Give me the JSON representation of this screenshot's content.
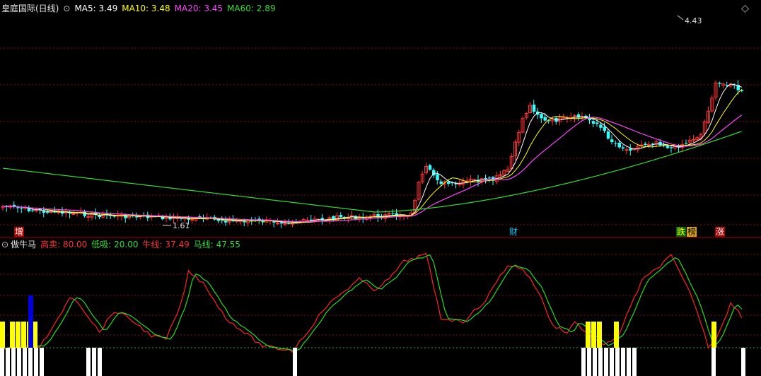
{
  "main_panel": {
    "title": "皇庭国际(日线)",
    "ma_labels": [
      {
        "text": "MA5: 3.49",
        "color": "#ffffff"
      },
      {
        "text": "MA10: 3.48",
        "color": "#ffff00"
      },
      {
        "text": "MA20: 3.45",
        "color": "#ff44ff"
      },
      {
        "text": "MA60: 2.89",
        "color": "#33dd33"
      }
    ],
    "high_label": "4.43",
    "low_label": "1.61",
    "event_tags": [
      {
        "text": "增",
        "color": "#ffffff",
        "bg": "#aa0000"
      },
      {
        "text": "财",
        "color": "#00ccff",
        "bg": "#000000"
      },
      {
        "text": "跌",
        "color": "#ffff00",
        "bg": "#006600"
      },
      {
        "text": "榜",
        "color": "#000000",
        "bg": "#ddaa00"
      },
      {
        "text": "涨",
        "color": "#ffffff",
        "bg": "#aa0000"
      }
    ]
  },
  "indicator_panel": {
    "name": "做牛马",
    "params": [
      {
        "text": "高卖: 80.00",
        "color": "#ff3333"
      },
      {
        "text": "低吸: 20.00",
        "color": "#33dd33"
      },
      {
        "text": "牛线: 37.49",
        "color": "#ff3333"
      },
      {
        "text": "马线: 47.55",
        "color": "#33dd33"
      }
    ]
  },
  "colors": {
    "up": "#ff3333",
    "down": "#33ffff",
    "ma5": "#ffffff",
    "ma10": "#ffff00",
    "ma20": "#ff44ff",
    "ma60": "#33dd33",
    "grid": "#881111",
    "yellow_bar": "#ffff00",
    "blue_bar": "#0000dd",
    "white_bar": "#ffffff"
  }
}
